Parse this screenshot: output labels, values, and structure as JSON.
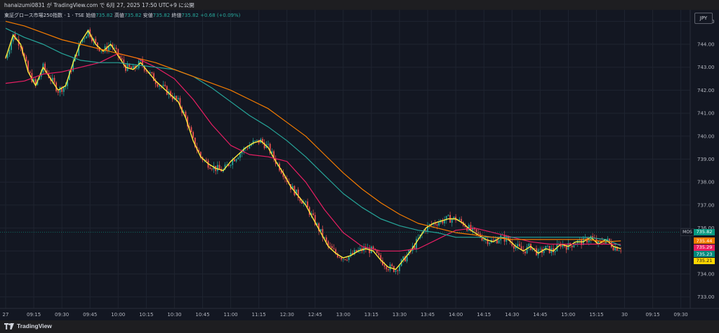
{
  "header": {
    "attribution": "hanaizumi0831 が TradingView.com で 6月 27, 2025 17:50 UTC+9 に公開"
  },
  "legend": {
    "symbol": "東証グロース市場250指数 · 1 · TSE",
    "open_label": "始値",
    "open_value": "735.82",
    "high_label": "高値",
    "high_value": "735.82",
    "low_label": "安値",
    "low_value": "735.82",
    "close_label": "終値",
    "close_value": "735.82",
    "change": "+0.68 (+0.09%)"
  },
  "currency_button": "JPY",
  "symbol_tag": "MOS",
  "price_labels": [
    {
      "text": "735.82",
      "value": 735.82,
      "color": "#089981"
    },
    {
      "text": "735.44",
      "value": 735.44,
      "color": "#f57c00"
    },
    {
      "text": "735.29",
      "value": 735.29,
      "color": "#e91e63"
    },
    {
      "text": "735.23",
      "value": 735.23,
      "color": "#00897b"
    },
    {
      "text": "735.21",
      "value": 735.21,
      "color": "#ffd600"
    }
  ],
  "footer": {
    "brand": "TradingView"
  },
  "chart_data": {
    "type": "line",
    "title": "",
    "xlabel": "",
    "ylabel": "",
    "grid": true,
    "ylim": [
      732.5,
      745.5
    ],
    "y_ticks": [
      "745.00",
      "744.00",
      "743.00",
      "742.00",
      "741.00",
      "740.00",
      "739.00",
      "738.00",
      "737.00",
      "736.00",
      "735.00",
      "734.00",
      "733.00"
    ],
    "y_tick_values": [
      745,
      744,
      743,
      742,
      741,
      740,
      739,
      738,
      737,
      736,
      735,
      734,
      733
    ],
    "x_ticks": [
      "27",
      "09:15",
      "09:30",
      "09:45",
      "10:00",
      "10:15",
      "10:30",
      "10:45",
      "11:00",
      "11:15",
      "12:30",
      "12:45",
      "13:00",
      "13:15",
      "13:30",
      "13:45",
      "14:00",
      "14:15",
      "14:30",
      "14:45",
      "15:00",
      "15:15",
      "30",
      "09:15",
      "09:30"
    ],
    "x_tick_slots": [
      0,
      15,
      30,
      45,
      60,
      75,
      90,
      105,
      120,
      135,
      150,
      165,
      180,
      195,
      210,
      225,
      240,
      255,
      270,
      285,
      300,
      315,
      330,
      345,
      360
    ],
    "x_slot_range": [
      -3,
      365
    ],
    "last_price": 735.82,
    "series": [
      {
        "color": "#ffeb3b",
        "points": [
          [
            0,
            743.4
          ],
          [
            4,
            744.4
          ],
          [
            8,
            744.0
          ],
          [
            12,
            742.8
          ],
          [
            16,
            742.2
          ],
          [
            20,
            743.0
          ],
          [
            24,
            742.5
          ],
          [
            28,
            742.0
          ],
          [
            32,
            742.2
          ],
          [
            36,
            743.2
          ],
          [
            40,
            744.1
          ],
          [
            44,
            744.6
          ],
          [
            48,
            744.0
          ],
          [
            52,
            743.7
          ],
          [
            56,
            744.0
          ],
          [
            60,
            743.5
          ],
          [
            64,
            743.0
          ],
          [
            68,
            742.9
          ],
          [
            72,
            743.2
          ],
          [
            76,
            742.8
          ],
          [
            80,
            742.4
          ],
          [
            84,
            742.1
          ],
          [
            88,
            741.8
          ],
          [
            92,
            741.5
          ],
          [
            96,
            740.8
          ],
          [
            100,
            739.8
          ],
          [
            104,
            739.1
          ],
          [
            108,
            738.8
          ],
          [
            112,
            738.6
          ],
          [
            116,
            738.5
          ],
          [
            120,
            738.9
          ],
          [
            124,
            739.2
          ],
          [
            128,
            739.5
          ],
          [
            132,
            739.7
          ],
          [
            136,
            739.8
          ],
          [
            140,
            739.5
          ],
          [
            144,
            738.9
          ],
          [
            148,
            738.4
          ],
          [
            152,
            737.8
          ],
          [
            156,
            737.4
          ],
          [
            160,
            737.0
          ],
          [
            164,
            736.4
          ],
          [
            168,
            735.8
          ],
          [
            172,
            735.2
          ],
          [
            176,
            734.9
          ],
          [
            180,
            734.7
          ],
          [
            184,
            734.8
          ],
          [
            188,
            735.0
          ],
          [
            192,
            735.1
          ],
          [
            196,
            735.0
          ],
          [
            200,
            734.6
          ],
          [
            204,
            734.3
          ],
          [
            208,
            734.2
          ],
          [
            212,
            734.6
          ],
          [
            216,
            735.0
          ],
          [
            220,
            735.5
          ],
          [
            224,
            736.0
          ],
          [
            228,
            736.2
          ],
          [
            232,
            736.3
          ],
          [
            236,
            736.4
          ],
          [
            240,
            736.4
          ],
          [
            244,
            736.2
          ],
          [
            248,
            735.9
          ],
          [
            252,
            735.7
          ],
          [
            256,
            735.5
          ],
          [
            260,
            735.4
          ],
          [
            264,
            735.6
          ],
          [
            268,
            735.5
          ],
          [
            272,
            735.2
          ],
          [
            276,
            735.0
          ],
          [
            280,
            735.2
          ],
          [
            284,
            734.9
          ],
          [
            288,
            735.1
          ],
          [
            292,
            735.0
          ],
          [
            296,
            735.3
          ],
          [
            300,
            735.2
          ],
          [
            304,
            735.4
          ],
          [
            308,
            735.4
          ],
          [
            312,
            735.6
          ],
          [
            316,
            735.3
          ],
          [
            320,
            735.5
          ],
          [
            324,
            735.2
          ],
          [
            328,
            735.1
          ]
        ]
      },
      {
        "color": "#e91e63",
        "points": [
          [
            0,
            742.3
          ],
          [
            10,
            742.4
          ],
          [
            20,
            742.7
          ],
          [
            30,
            742.8
          ],
          [
            40,
            743.0
          ],
          [
            50,
            743.2
          ],
          [
            60,
            743.6
          ],
          [
            70,
            743.4
          ],
          [
            80,
            743.0
          ],
          [
            90,
            742.5
          ],
          [
            100,
            741.6
          ],
          [
            110,
            740.5
          ],
          [
            120,
            739.6
          ],
          [
            130,
            739.2
          ],
          [
            140,
            739.1
          ],
          [
            150,
            738.9
          ],
          [
            160,
            738.0
          ],
          [
            170,
            736.8
          ],
          [
            180,
            735.8
          ],
          [
            190,
            735.2
          ],
          [
            200,
            735.0
          ],
          [
            210,
            735.0
          ],
          [
            220,
            735.1
          ],
          [
            230,
            735.5
          ],
          [
            240,
            735.9
          ],
          [
            250,
            736.0
          ],
          [
            260,
            735.8
          ],
          [
            270,
            735.6
          ],
          [
            280,
            735.4
          ],
          [
            290,
            735.3
          ],
          [
            300,
            735.3
          ],
          [
            310,
            735.3
          ],
          [
            320,
            735.3
          ],
          [
            328,
            735.29
          ]
        ]
      },
      {
        "color": "#26a69a",
        "points": [
          [
            0,
            744.7
          ],
          [
            10,
            744.3
          ],
          [
            20,
            744.0
          ],
          [
            30,
            743.6
          ],
          [
            40,
            743.3
          ],
          [
            50,
            743.2
          ],
          [
            60,
            743.2
          ],
          [
            70,
            743.1
          ],
          [
            80,
            743.0
          ],
          [
            90,
            742.9
          ],
          [
            100,
            742.6
          ],
          [
            110,
            742.1
          ],
          [
            120,
            741.5
          ],
          [
            130,
            740.9
          ],
          [
            140,
            740.4
          ],
          [
            150,
            739.8
          ],
          [
            160,
            739.1
          ],
          [
            170,
            738.3
          ],
          [
            180,
            737.5
          ],
          [
            190,
            736.9
          ],
          [
            200,
            736.4
          ],
          [
            210,
            736.1
          ],
          [
            220,
            735.9
          ],
          [
            230,
            735.8
          ],
          [
            240,
            735.6
          ],
          [
            250,
            735.6
          ],
          [
            260,
            735.6
          ],
          [
            270,
            735.6
          ],
          [
            280,
            735.6
          ],
          [
            290,
            735.6
          ],
          [
            300,
            735.6
          ],
          [
            310,
            735.6
          ],
          [
            320,
            735.5
          ],
          [
            328,
            735.23
          ]
        ]
      },
      {
        "color": "#f57c00",
        "points": [
          [
            0,
            745.0
          ],
          [
            10,
            744.8
          ],
          [
            20,
            744.5
          ],
          [
            30,
            744.2
          ],
          [
            40,
            744.0
          ],
          [
            50,
            743.8
          ],
          [
            60,
            743.6
          ],
          [
            70,
            743.4
          ],
          [
            80,
            743.2
          ],
          [
            90,
            742.9
          ],
          [
            100,
            742.6
          ],
          [
            110,
            742.3
          ],
          [
            120,
            742.0
          ],
          [
            130,
            741.6
          ],
          [
            140,
            741.2
          ],
          [
            150,
            740.6
          ],
          [
            160,
            740.0
          ],
          [
            170,
            739.2
          ],
          [
            180,
            738.4
          ],
          [
            190,
            737.7
          ],
          [
            200,
            737.1
          ],
          [
            210,
            736.6
          ],
          [
            220,
            736.2
          ],
          [
            230,
            736.0
          ],
          [
            240,
            735.8
          ],
          [
            250,
            735.7
          ],
          [
            260,
            735.6
          ],
          [
            270,
            735.5
          ],
          [
            280,
            735.5
          ],
          [
            290,
            735.5
          ],
          [
            300,
            735.5
          ],
          [
            310,
            735.5
          ],
          [
            320,
            735.4
          ],
          [
            328,
            735.44
          ]
        ]
      }
    ]
  }
}
